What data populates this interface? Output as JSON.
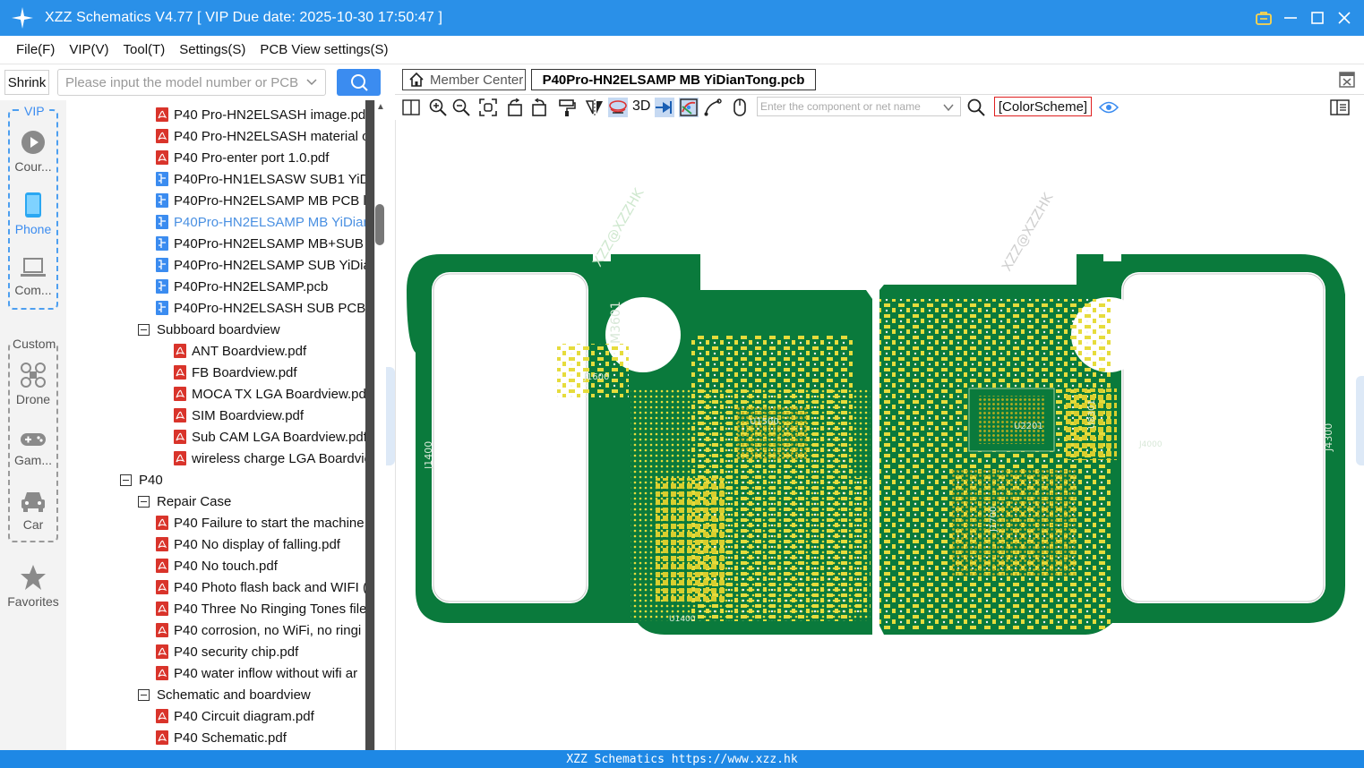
{
  "window": {
    "title": "XZZ Schematics V4.77 [ VIP Due date: 2025-10-30 17:50:47 ]"
  },
  "menu": [
    "File(F)",
    "VIP(V)",
    "Tool(T)",
    "Settings(S)",
    "PCB View settings(S)"
  ],
  "search": {
    "shrink_label": "Shrink",
    "placeholder": "Please input the model number or PCB"
  },
  "leftnav": {
    "vip_label": "VIP",
    "custom_label": "Custom",
    "items": [
      "Cour...",
      "Phone",
      "Com...",
      "Drone",
      "Gam...",
      "Car",
      "Favorites"
    ]
  },
  "tree": [
    {
      "label": "P40 Pro-HN2ELSASH image.pdf",
      "type": "pdf"
    },
    {
      "label": "P40 Pro-HN2ELSASH material o",
      "type": "pdf"
    },
    {
      "label": "P40 Pro-enter port 1.0.pdf",
      "type": "pdf"
    },
    {
      "label": "P40Pro-HN1ELSASW SUB1 YiDia",
      "type": "pcb"
    },
    {
      "label": "P40Pro-HN2ELSAMP MB PCB la",
      "type": "pcb"
    },
    {
      "label": "P40Pro-HN2ELSAMP MB YiDian",
      "type": "pcb",
      "selected": true
    },
    {
      "label": "P40Pro-HN2ELSAMP MB+SUB I",
      "type": "pcb"
    },
    {
      "label": "P40Pro-HN2ELSAMP SUB YiDia",
      "type": "pcb"
    },
    {
      "label": "P40Pro-HN2ELSAMP.pcb",
      "type": "pcb"
    },
    {
      "label": "P40Pro-HN2ELSASH SUB PCB la",
      "type": "pcb"
    },
    {
      "label": "Subboard boardview",
      "type": "folder"
    },
    {
      "label": "ANT Boardview.pdf",
      "type": "pdf"
    },
    {
      "label": "FB Boardview.pdf",
      "type": "pdf"
    },
    {
      "label": "MOCA TX LGA Boardview.pd",
      "type": "pdf"
    },
    {
      "label": "SIM Boardview.pdf",
      "type": "pdf"
    },
    {
      "label": "Sub CAM LGA Boardview.pdf",
      "type": "pdf"
    },
    {
      "label": "wireless charge LGA Boardvie",
      "type": "pdf"
    },
    {
      "label": "P40",
      "type": "folder"
    },
    {
      "label": "Repair Case",
      "type": "folder"
    },
    {
      "label": "P40 Failure to start the machine",
      "type": "pdf"
    },
    {
      "label": "P40 No display of falling.pdf",
      "type": "pdf"
    },
    {
      "label": "P40 No touch.pdf",
      "type": "pdf"
    },
    {
      "label": "P40 Photo flash back and WIFI (",
      "type": "pdf"
    },
    {
      "label": "P40 Three No Ringing Tones file",
      "type": "pdf"
    },
    {
      "label": "P40 corrosion, no WiFi, no ringi",
      "type": "pdf"
    },
    {
      "label": "P40 security chip.pdf",
      "type": "pdf"
    },
    {
      "label": "P40 water inflow without wifi ar",
      "type": "pdf"
    },
    {
      "label": "Schematic and boardview",
      "type": "folder"
    },
    {
      "label": "P40 Circuit diagram.pdf",
      "type": "pdf"
    },
    {
      "label": "P40 Schematic.pdf",
      "type": "pdf"
    }
  ],
  "tabs": {
    "member": "Member Center",
    "active": "P40Pro-HN2ELSAMP MB YiDianTong.pcb"
  },
  "toolbar": {
    "label_3d": "3D",
    "component_placeholder": "Enter the component or net name",
    "color_scheme": "[ColorScheme]"
  },
  "board": {
    "watermark": "XZZ@XZZHK",
    "component_labels": [
      "M3601",
      "J1400",
      "J1600",
      "U1500",
      "U1400",
      "U2201",
      "J1700",
      "U8301",
      "J4000",
      "J4300"
    ]
  },
  "status": "XZZ Schematics https://www.xzz.hk",
  "colors": {
    "titlebar": "#2a90e8",
    "pcb_green": "#0a7a3c",
    "pad_yellow": "#e6dc3c",
    "accent": "#3b8cf0"
  }
}
